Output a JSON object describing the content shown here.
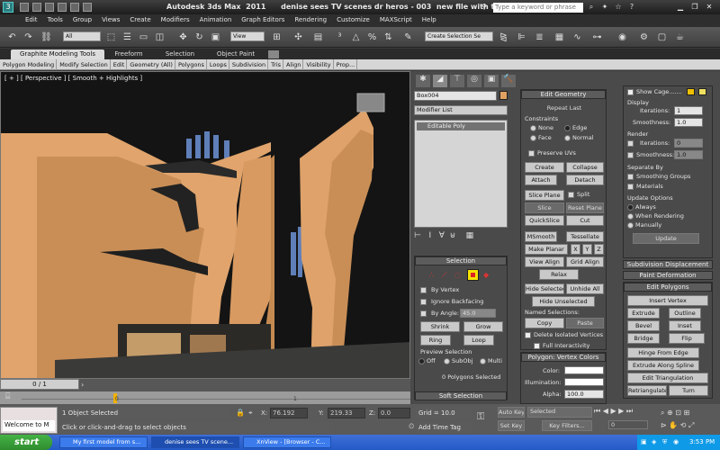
{
  "window": {
    "title": "Autodesk 3ds Max  2011      denise sees TV scenes dr heros - 003  new file with tv.max",
    "app_icon": "3ds-max-logo-icon",
    "search_placeholder": "Type a keyword or phrase"
  },
  "menu": [
    "Edit",
    "Tools",
    "Group",
    "Views",
    "Create",
    "Modifiers",
    "Animation",
    "Graph Editors",
    "Rendering",
    "Customize",
    "MAXScript",
    "Help"
  ],
  "toolbar": {
    "selection_filter": "All",
    "ref_coord": "View",
    "named_selection": "Create Selection Se"
  },
  "ribbon": {
    "tabs": [
      "Graphite Modeling Tools",
      "Freeform",
      "Selection",
      "Object Paint"
    ],
    "sub": [
      "Polygon Modeling",
      "Modify Selection",
      "Edit",
      "Geometry (All)",
      "Polygons",
      "Loops",
      "Subdivision",
      "Tris",
      "Align",
      "Visibility",
      "Prop..."
    ]
  },
  "viewport": {
    "label": "[ + ] [ Perspective ] [ Smooth + Highlights ]"
  },
  "time": {
    "slider": "0 / 1",
    "track_ticks": [
      "0",
      "1"
    ]
  },
  "status": {
    "listener": "Welcome to M",
    "selected": "1 Object Selected",
    "prompt": "Click or click-and-drag to select objects",
    "x_label": "X:",
    "x": "76.192",
    "y_label": "Y:",
    "y": "219.33",
    "z_label": "Z:",
    "z": "0.0",
    "grid": "Grid = 10.0",
    "add_time_tag": "Add Time Tag",
    "auto_key": "Auto Key",
    "set_key": "Set Key",
    "key_mode": "Selected",
    "key_filters": "Key Filters...",
    "frame": "0"
  },
  "modify": {
    "object_name": "Box004",
    "object_color": "#e0a060",
    "modifier_list": "Modifier List",
    "stack": [
      "Editable Poly"
    ]
  },
  "selection_rollout": {
    "title": "Selection",
    "by_vertex": "By Vertex",
    "ignore_backfacing": "Ignore Backfacing",
    "by_angle": "By Angle:",
    "angle": "45.0",
    "shrink": "Shrink",
    "grow": "Grow",
    "ring": "Ring",
    "loop": "Loop",
    "preview_title": "Preview Selection",
    "preview_opts": [
      "Off",
      "SubObj",
      "Multi"
    ],
    "status": "0 Polygons Selected",
    "soft_selection": "Soft Selection"
  },
  "edit_geometry": {
    "title": "Edit Geometry",
    "repeat_last": "Repeat Last",
    "constraints": "Constraints",
    "c_none": "None",
    "c_edge": "Edge",
    "c_face": "Face",
    "c_normal": "Normal",
    "preserve_uvs": "Preserve UVs",
    "create": "Create",
    "collapse": "Collapse",
    "attach": "Attach",
    "detach": "Detach",
    "slice_plane": "Slice Plane",
    "split": "Split",
    "slice": "Slice",
    "reset_plane": "Reset Plane",
    "quickslice": "QuickSlice",
    "cut": "Cut",
    "msmooth": "MSmooth",
    "tessellate": "Tessellate",
    "make_planar": "Make Planar",
    "x": "X",
    "y": "Y",
    "z": "Z",
    "view_align": "View Align",
    "grid_align": "Grid Align",
    "relax": "Relax",
    "hide_selected": "Hide Selected",
    "unhide_all": "Unhide All",
    "hide_unselected": "Hide Unselected",
    "named_selections": "Named Selections:",
    "copy": "Copy",
    "paste": "Paste",
    "delete_isolated": "Delete Isolated Vertices",
    "full_interactivity": "Full Interactivity"
  },
  "vertex_colors": {
    "title": "Polygon: Vertex Colors",
    "color": "Color:",
    "illumination": "Illumination:",
    "alpha": "Alpha:",
    "alpha_val": "100.0"
  },
  "subdivision": {
    "show_cage": "Show Cage.......",
    "cage_color1": "#f0c000",
    "cage_color2": "#f0e060",
    "display": "Display",
    "iterations": "Iterations:",
    "iterations_val": "1",
    "smoothness": "Smoothness:",
    "smoothness_val": "1.0",
    "render": "Render",
    "r_iterations_val": "0",
    "r_smoothness_val": "1.0",
    "separate_by": "Separate By",
    "smoothing_groups": "Smoothing Groups",
    "materials": "Materials",
    "update_options": "Update Options",
    "always": "Always",
    "when_rendering": "When Rendering",
    "manually": "Manually",
    "update": "Update"
  },
  "right_rollouts": {
    "subdiv_displacement": "Subdivision Displacement",
    "paint_deformation": "Paint Deformation",
    "edit_polygons": "Edit Polygons",
    "insert_vertex": "Insert Vertex",
    "extrude": "Extrude",
    "outline": "Outline",
    "bevel": "Bevel",
    "inset": "Inset",
    "bridge": "Bridge",
    "flip": "Flip",
    "hinge_from_edge": "Hinge From Edge",
    "extrude_along_spline": "Extrude Along Spline",
    "edit_triangulation": "Edit Triangulation",
    "retriangulate": "Retriangulate",
    "turn": "Turn"
  },
  "taskbar": {
    "start": "start",
    "tasks": [
      "My first model from s...",
      "denise sees TV scene...",
      "XnView - [Browser - C..."
    ],
    "clock": "3:53 PM"
  }
}
